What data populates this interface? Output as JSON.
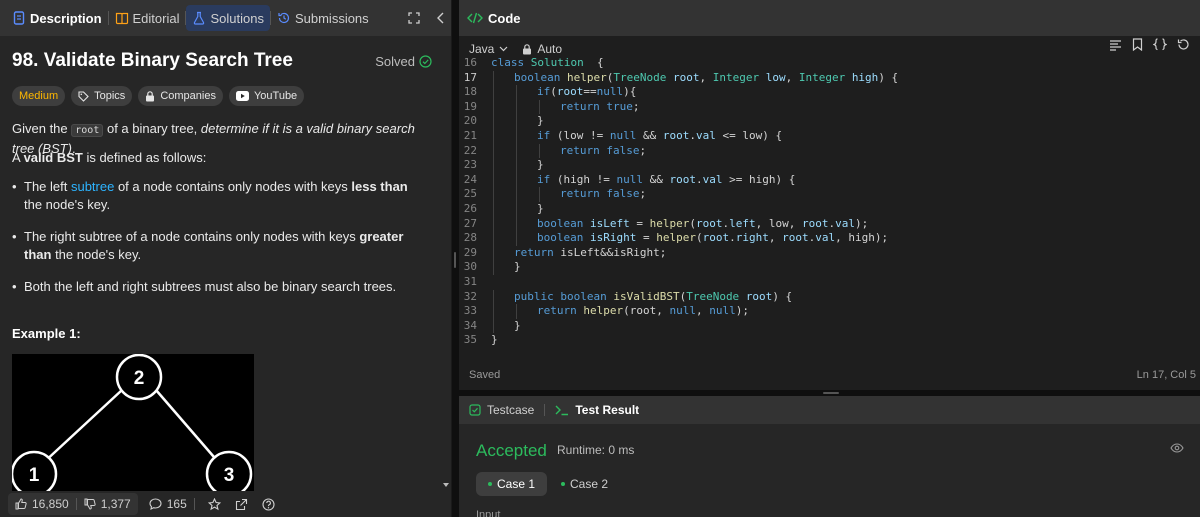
{
  "tabs": {
    "description": "Description",
    "editorial": "Editorial",
    "solutions": "Solutions",
    "submissions": "Submissions"
  },
  "problem": {
    "title": "98. Validate Binary Search Tree",
    "status": "Solved",
    "tags": {
      "difficulty": "Medium",
      "topics": "Topics",
      "companies": "Companies",
      "youtube": "YouTube"
    },
    "intro_before": "Given the ",
    "intro_code": "root",
    "intro_mid": " of a binary tree, ",
    "intro_em": "determine if it is a valid binary search tree (BST)",
    "intro_after": ".",
    "valid_pre": "A ",
    "valid_bold": "valid BST",
    "valid_post": " is defined as follows:",
    "bullet1_a": "The left ",
    "bullet1_link": "subtree",
    "bullet1_b": " of a node contains only nodes with keys ",
    "bullet1_bold": "less than",
    "bullet1_c": " the node's key.",
    "bullet2_a": "The right subtree of a node contains only nodes with keys ",
    "bullet2_bold": "greater than",
    "bullet2_b": " the node's key.",
    "bullet3": "Both the left and right subtrees must also be binary search trees.",
    "example_heading": "Example 1:",
    "tree_nodes": [
      "2",
      "1",
      "3"
    ]
  },
  "footer": {
    "likes": "16,850",
    "dislikes": "1,377",
    "comments": "165"
  },
  "code_panel": {
    "title": "Code",
    "language": "Java",
    "mode": "Auto",
    "status_left": "Saved",
    "status_right": "Ln 17, Col 5",
    "current_line": "17",
    "lines": [
      {
        "n": "16",
        "indent": 0,
        "tokens": [
          [
            "kw",
            "class "
          ],
          [
            "ty",
            "Solution"
          ],
          [
            "",
            "  {"
          ]
        ]
      },
      {
        "n": "17",
        "indent": 1,
        "tokens": [
          [
            "kw",
            "boolean "
          ],
          [
            "fn",
            "helper"
          ],
          [
            "",
            "("
          ],
          [
            "ty",
            "TreeNode "
          ],
          [
            "vr",
            "root"
          ],
          [
            "",
            ", "
          ],
          [
            "ty",
            "Integer "
          ],
          [
            "vr",
            "low"
          ],
          [
            "",
            ", "
          ],
          [
            "ty",
            "Integer "
          ],
          [
            "vr",
            "high"
          ],
          [
            "",
            ") {"
          ]
        ]
      },
      {
        "n": "18",
        "indent": 2,
        "tokens": [
          [
            "kw",
            "if"
          ],
          [
            "",
            "("
          ],
          [
            "vr",
            "root"
          ],
          [
            "",
            "=="
          ],
          [
            "kw",
            "null"
          ],
          [
            "",
            "){"
          ]
        ]
      },
      {
        "n": "19",
        "indent": 3,
        "tokens": [
          [
            "kw",
            "return "
          ],
          [
            "kw",
            "true"
          ],
          [
            "",
            ";"
          ]
        ]
      },
      {
        "n": "20",
        "indent": 2,
        "tokens": [
          [
            "",
            "}"
          ]
        ]
      },
      {
        "n": "21",
        "indent": 2,
        "tokens": [
          [
            "kw",
            "if "
          ],
          [
            "",
            "(low != "
          ],
          [
            "kw",
            "null"
          ],
          [
            "",
            " && "
          ],
          [
            "vr",
            "root"
          ],
          [
            "",
            "."
          ],
          [
            "vr",
            "val"
          ],
          [
            "",
            " <= low) {"
          ]
        ]
      },
      {
        "n": "22",
        "indent": 3,
        "tokens": [
          [
            "kw",
            "return "
          ],
          [
            "kw",
            "false"
          ],
          [
            "",
            ";"
          ]
        ]
      },
      {
        "n": "23",
        "indent": 2,
        "tokens": [
          [
            "",
            "}"
          ]
        ]
      },
      {
        "n": "24",
        "indent": 2,
        "tokens": [
          [
            "kw",
            "if "
          ],
          [
            "",
            "(high != "
          ],
          [
            "kw",
            "null"
          ],
          [
            "",
            " && "
          ],
          [
            "vr",
            "root"
          ],
          [
            "",
            "."
          ],
          [
            "vr",
            "val"
          ],
          [
            "",
            " >= high) {"
          ]
        ]
      },
      {
        "n": "25",
        "indent": 3,
        "tokens": [
          [
            "kw",
            "return "
          ],
          [
            "kw",
            "false"
          ],
          [
            "",
            ";"
          ]
        ]
      },
      {
        "n": "26",
        "indent": 2,
        "tokens": [
          [
            "",
            "}"
          ]
        ]
      },
      {
        "n": "27",
        "indent": 2,
        "tokens": [
          [
            "kw",
            "boolean "
          ],
          [
            "vr",
            "isLeft"
          ],
          [
            "",
            " = "
          ],
          [
            "fn",
            "helper"
          ],
          [
            "",
            "("
          ],
          [
            "vr",
            "root"
          ],
          [
            "",
            "."
          ],
          [
            "vr",
            "left"
          ],
          [
            "",
            ", low, "
          ],
          [
            "vr",
            "root"
          ],
          [
            "",
            "."
          ],
          [
            "vr",
            "val"
          ],
          [
            "",
            ");"
          ]
        ]
      },
      {
        "n": "28",
        "indent": 2,
        "tokens": [
          [
            "kw",
            "boolean "
          ],
          [
            "vr",
            "isRight"
          ],
          [
            "",
            " = "
          ],
          [
            "fn",
            "helper"
          ],
          [
            "",
            "("
          ],
          [
            "vr",
            "root"
          ],
          [
            "",
            "."
          ],
          [
            "vr",
            "right"
          ],
          [
            "",
            ", "
          ],
          [
            "vr",
            "root"
          ],
          [
            "",
            "."
          ],
          [
            "vr",
            "val"
          ],
          [
            "",
            ", high);"
          ]
        ]
      },
      {
        "n": "29",
        "indent": 1,
        "tokens": [
          [
            "kw",
            "return "
          ],
          [
            "",
            "isLeft&&isRight;"
          ]
        ]
      },
      {
        "n": "30",
        "indent": 1,
        "tokens": [
          [
            "",
            "}"
          ]
        ]
      },
      {
        "n": "31",
        "indent": 0,
        "tokens": []
      },
      {
        "n": "32",
        "indent": 1,
        "tokens": [
          [
            "kw",
            "public "
          ],
          [
            "kw",
            "boolean "
          ],
          [
            "fn",
            "isValidBST"
          ],
          [
            "",
            "("
          ],
          [
            "ty",
            "TreeNode "
          ],
          [
            "vr",
            "root"
          ],
          [
            "",
            ") {"
          ]
        ]
      },
      {
        "n": "33",
        "indent": 2,
        "tokens": [
          [
            "kw",
            "return "
          ],
          [
            "fn",
            "helper"
          ],
          [
            "",
            "(root, "
          ],
          [
            "kw",
            "null"
          ],
          [
            "",
            ", "
          ],
          [
            "kw",
            "null"
          ],
          [
            "",
            ");"
          ]
        ]
      },
      {
        "n": "34",
        "indent": 1,
        "tokens": [
          [
            "",
            "}"
          ]
        ]
      },
      {
        "n": "35",
        "indent": 0,
        "tokens": [
          [
            "",
            "}"
          ]
        ]
      }
    ]
  },
  "result_panel": {
    "testcase_tab": "Testcase",
    "result_tab": "Test Result",
    "verdict": "Accepted",
    "runtime": "Runtime: 0 ms",
    "case1": "Case 1",
    "case2": "Case 2",
    "input_label": "Input"
  },
  "colors": {
    "accepted_green": "#2cbb5d",
    "medium_yellow": "#ffb800",
    "link_blue": "#2db4ff",
    "active_tab_blue": "#5a8cff"
  }
}
